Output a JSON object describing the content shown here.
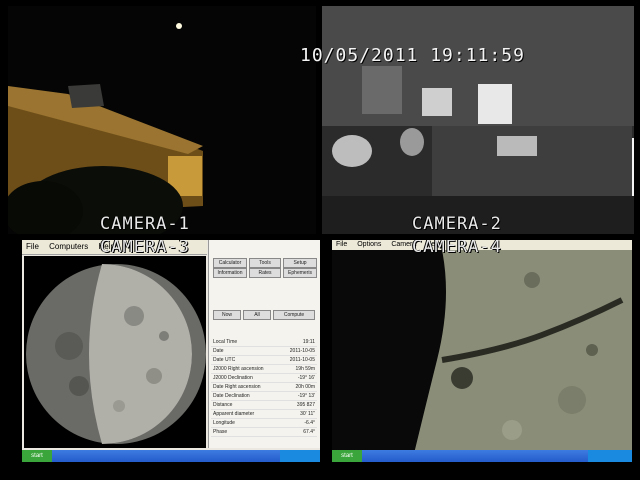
{
  "osd": {
    "timestamp": "10/05/2011 19:11:59"
  },
  "cameras": [
    {
      "label": "CAMERA-1"
    },
    {
      "label": "CAMERA-2"
    },
    {
      "label": "CAMERA-3"
    },
    {
      "label": "CAMERA-4"
    }
  ],
  "cam3_app": {
    "menu": [
      "File",
      "Computers",
      "Help"
    ],
    "buttons": [
      "Calculator",
      "Tools",
      "Setup",
      "Information",
      "Rates",
      "Ephemeris",
      "Now",
      "All",
      "Compute"
    ],
    "properties": [
      {
        "key": "Local Time",
        "value": "19:11"
      },
      {
        "key": "Date",
        "value": "2011-10-05"
      },
      {
        "key": "Date UTC",
        "value": "2011-10-05"
      },
      {
        "key": "J2000 Right ascension",
        "value": "19h 59m"
      },
      {
        "key": "J2000 Declination",
        "value": "-19° 16'"
      },
      {
        "key": "Date Right ascension",
        "value": "20h 00m"
      },
      {
        "key": "Date Declination",
        "value": "-19° 13'"
      },
      {
        "key": "Distance",
        "value": "395 827"
      },
      {
        "key": "Apparent diameter",
        "value": "30' 11\""
      },
      {
        "key": "Longitude",
        "value": "-6.4°"
      },
      {
        "key": "Phase",
        "value": "67.4°"
      }
    ],
    "taskbar": {
      "start_label": "start"
    }
  },
  "cam4_app": {
    "menu": [
      "File",
      "Options",
      "Camera",
      "Help"
    ],
    "taskbar": {
      "start_label": "start"
    }
  },
  "colors": {
    "osd_text": "#e8e8e8",
    "cam1_window_glow": "#c89a3a",
    "moon_gray": "#9a9a94",
    "xp_taskbar": "#245ccc"
  }
}
